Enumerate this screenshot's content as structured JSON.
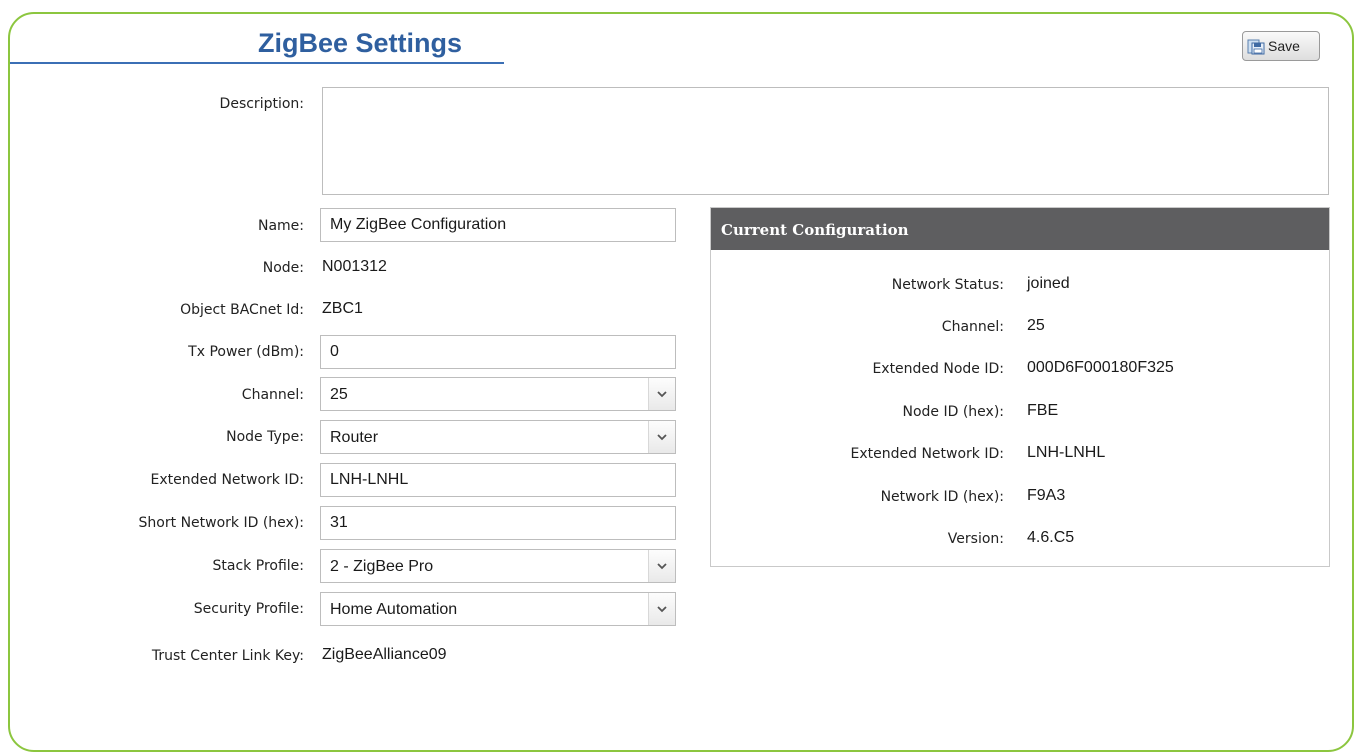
{
  "page": {
    "title": "ZigBee Settings",
    "save_label": "Save"
  },
  "form": {
    "description_label": "Description:",
    "description_value": "",
    "name_label": "Name:",
    "name_value": "My ZigBee Configuration",
    "node_label": "Node:",
    "node_value": "N001312",
    "bacnet_label": "Object BACnet Id:",
    "bacnet_value": "ZBC1",
    "tx_power_label": "Tx Power (dBm):",
    "tx_power_value": "0",
    "channel_label": "Channel:",
    "channel_value": "25",
    "node_type_label": "Node Type:",
    "node_type_value": "Router",
    "ext_net_id_label": "Extended Network ID:",
    "ext_net_id_value": "LNH-LNHL",
    "short_net_id_label": "Short Network ID (hex):",
    "short_net_id_value": "31",
    "stack_profile_label": "Stack Profile:",
    "stack_profile_value": "2 - ZigBee Pro",
    "security_profile_label": "Security Profile:",
    "security_profile_value": "Home Automation",
    "trust_key_label": "Trust Center Link Key:",
    "trust_key_value": "ZigBeeAlliance09"
  },
  "current_config": {
    "header": "Current Configuration",
    "network_status_label": "Network Status:",
    "network_status_value": "joined",
    "channel_label": "Channel:",
    "channel_value": "25",
    "ext_node_id_label": "Extended Node ID:",
    "ext_node_id_value": "000D6F000180F325",
    "node_id_label": "Node ID (hex):",
    "node_id_value": "FBE",
    "ext_net_id_label": "Extended Network ID:",
    "ext_net_id_value": "LNH-LNHL",
    "net_id_label": "Network ID (hex):",
    "net_id_value": "F9A3",
    "version_label": "Version:",
    "version_value": "4.6.C5"
  },
  "icons": {
    "save": "save-icon",
    "dropdown": "chevron-down-icon"
  },
  "colors": {
    "frame": "#8cc63f",
    "title": "#2f5f9f",
    "panel_header": "#5e5e60"
  }
}
